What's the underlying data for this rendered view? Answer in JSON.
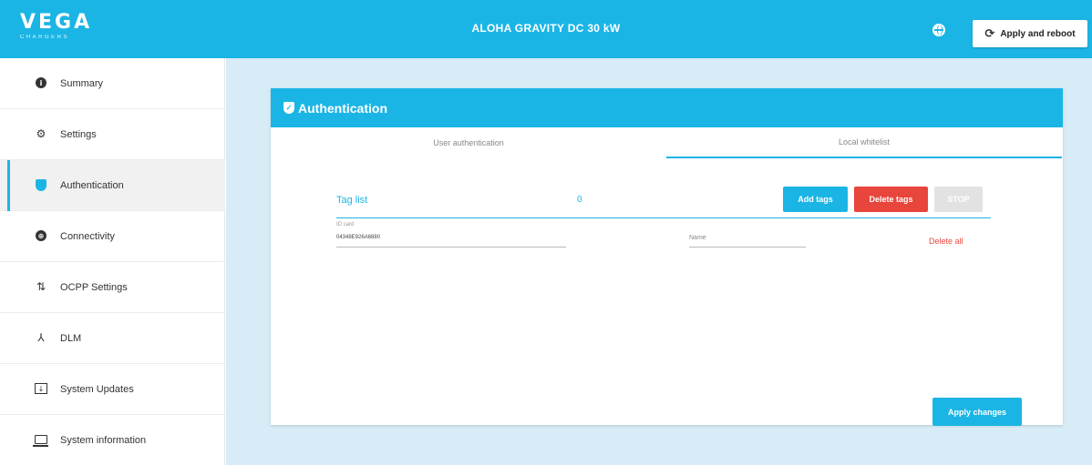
{
  "header": {
    "logo_text": "VEGA",
    "logo_subtext": "CHARGERS",
    "title": "ALOHA GRAVITY DC 30 kW",
    "reboot_label": "Apply and reboot"
  },
  "sidebar": {
    "items": [
      {
        "label": "Summary",
        "icon": "info-icon"
      },
      {
        "label": "Settings",
        "icon": "gear-icon"
      },
      {
        "label": "Authentication",
        "icon": "shield-icon",
        "active": true
      },
      {
        "label": "Connectivity",
        "icon": "globe-icon"
      },
      {
        "label": "OCPP Settings",
        "icon": "transfer-arrows-icon"
      },
      {
        "label": "DLM",
        "icon": "network-icon"
      },
      {
        "label": "System Updates",
        "icon": "update-icon"
      },
      {
        "label": "System information",
        "icon": "laptop-icon"
      }
    ]
  },
  "card": {
    "title": "Authentication",
    "tabs": [
      {
        "label": "User authentication",
        "active": false
      },
      {
        "label": "Local whitelist",
        "active": true
      }
    ],
    "tag_list_label": "Tag list",
    "tag_count": "0",
    "buttons": {
      "add": "Add tags",
      "delete": "Delete tags",
      "stop": "STOP"
    },
    "id_field": {
      "caption": "ID card",
      "value": "04348E926A6880"
    },
    "name_field": {
      "placeholder": "Name"
    },
    "delete_all": "Delete all",
    "apply_label": "Apply changes"
  },
  "colors": {
    "accent": "#1bb5e5",
    "danger": "#e8453c",
    "background": "#d7ecf6"
  }
}
